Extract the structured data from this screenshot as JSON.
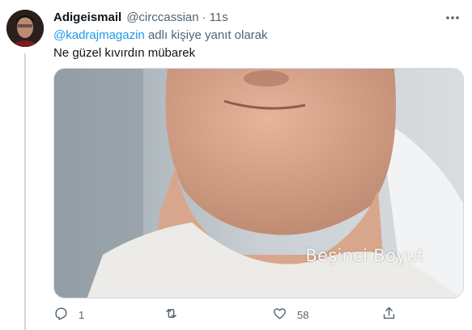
{
  "tweet": {
    "display_name": "Adigeismail",
    "handle": "@circcassian",
    "separator": "·",
    "time": "11s",
    "reply_to_link": "@kadrajmagazin",
    "reply_suffix": " adlı kişiye yanıt olarak",
    "text": "Ne güzel kıvırdın mübarek",
    "media_watermark": "Beşinci Boyut"
  },
  "actions": {
    "reply_count": "1",
    "retweet_count": "",
    "like_count": "58"
  },
  "icons": {
    "more": "more-icon",
    "reply": "reply-icon",
    "retweet": "retweet-icon",
    "like": "heart-icon",
    "share": "share-icon"
  },
  "colors": {
    "link": "#1d9bf0",
    "secondary_text": "#536471",
    "primary_text": "#0f1419"
  }
}
